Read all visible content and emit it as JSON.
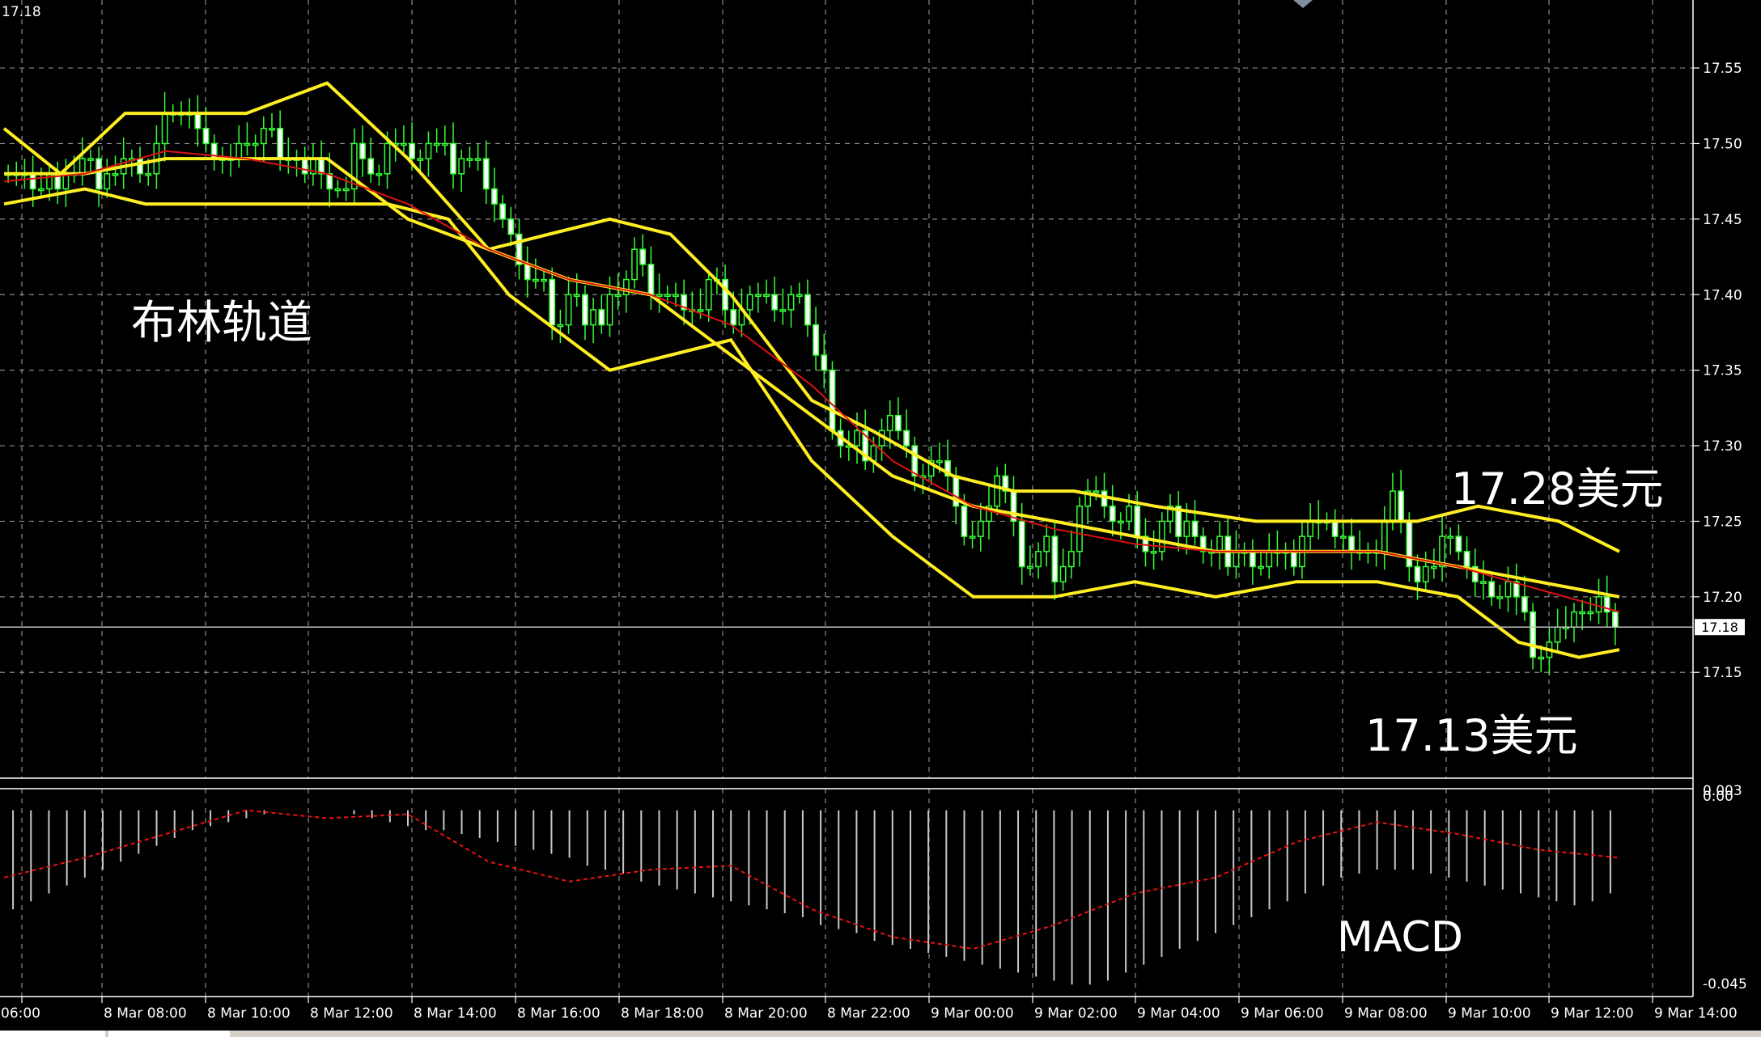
{
  "chart_data": [
    {
      "type": "candlestick",
      "corner_label": "17.18",
      "annotation_label": "布林轨道",
      "price_labels": [
        "17.28美元",
        "17.13美元"
      ],
      "current_price": "17.18",
      "ylim": [
        17.08,
        17.595
      ],
      "y_ticks": [
        "17.55",
        "17.50",
        "17.45",
        "17.40",
        "17.35",
        "17.30",
        "17.25",
        "17.20",
        "17.15"
      ],
      "x_ticks": [
        "06:00",
        "8 Mar 08:00",
        "8 Mar 10:00",
        "8 Mar 12:00",
        "8 Mar 14:00",
        "8 Mar 16:00",
        "8 Mar 18:00",
        "8 Mar 20:00",
        "8 Mar 22:00",
        "9 Mar 00:00",
        "9 Mar 02:00",
        "9 Mar 04:00",
        "9 Mar 06:00",
        "9 Mar 08:00",
        "9 Mar 10:00",
        "9 Mar 12:00",
        "9 Mar 14:00"
      ],
      "close": [
        17.48,
        17.48,
        17.48,
        17.47,
        17.47,
        17.48,
        17.47,
        17.48,
        17.48,
        17.49,
        17.49,
        17.47,
        17.48,
        17.48,
        17.49,
        17.49,
        17.48,
        17.48,
        17.5,
        17.52,
        17.52,
        17.52,
        17.52,
        17.51,
        17.5,
        17.49,
        17.49,
        17.49,
        17.5,
        17.5,
        17.5,
        17.51,
        17.51,
        17.49,
        17.49,
        17.49,
        17.48,
        17.49,
        17.48,
        17.47,
        17.47,
        17.47,
        17.5,
        17.49,
        17.48,
        17.48,
        17.5,
        17.5,
        17.5,
        17.49,
        17.49,
        17.5,
        17.5,
        17.5,
        17.48,
        17.49,
        17.49,
        17.49,
        17.47,
        17.46,
        17.45,
        17.44,
        17.42,
        17.41,
        17.41,
        17.41,
        17.38,
        17.38,
        17.4,
        17.4,
        17.38,
        17.39,
        17.38,
        17.4,
        17.4,
        17.41,
        17.43,
        17.42,
        17.4,
        17.4,
        17.4,
        17.4,
        17.39,
        17.39,
        17.39,
        17.41,
        17.41,
        17.39,
        17.38,
        17.39,
        17.4,
        17.4,
        17.4,
        17.39,
        17.39,
        17.4,
        17.4,
        17.38,
        17.36,
        17.35,
        17.31,
        17.3,
        17.3,
        17.31,
        17.29,
        17.3,
        17.31,
        17.32,
        17.31,
        17.3,
        17.28,
        17.28,
        17.29,
        17.29,
        17.28,
        17.26,
        17.24,
        17.24,
        17.25,
        17.26,
        17.28,
        17.27,
        17.25,
        17.22,
        17.22,
        17.23,
        17.24,
        17.21,
        17.22,
        17.23,
        17.26,
        17.27,
        17.27,
        17.26,
        17.25,
        17.25,
        17.26,
        17.24,
        17.23,
        17.23,
        17.25,
        17.26,
        17.24,
        17.25,
        17.24,
        17.23,
        17.23,
        17.24,
        17.22,
        17.23,
        17.23,
        17.22,
        17.22,
        17.23,
        17.23,
        17.23,
        17.22,
        17.24,
        17.25,
        17.25,
        17.25,
        17.24,
        17.24,
        17.23,
        17.23,
        17.23,
        17.23,
        17.25,
        17.27,
        17.25,
        17.22,
        17.21,
        17.22,
        17.22,
        17.24,
        17.24,
        17.23,
        17.22,
        17.21,
        17.21,
        17.2,
        17.2,
        17.21,
        17.2,
        17.19,
        17.16,
        17.16,
        17.17,
        17.18,
        17.18,
        17.19,
        17.19,
        17.19,
        17.2,
        17.19,
        17.18
      ],
      "open": [
        17.48,
        17.48,
        17.48,
        17.48,
        17.47,
        17.47,
        17.48,
        17.47,
        17.48,
        17.48,
        17.49,
        17.49,
        17.47,
        17.48,
        17.48,
        17.49,
        17.49,
        17.48,
        17.48,
        17.5,
        17.52,
        17.52,
        17.52,
        17.52,
        17.51,
        17.5,
        17.49,
        17.49,
        17.49,
        17.5,
        17.5,
        17.5,
        17.51,
        17.51,
        17.49,
        17.49,
        17.49,
        17.48,
        17.49,
        17.48,
        17.47,
        17.47,
        17.47,
        17.5,
        17.49,
        17.48,
        17.48,
        17.5,
        17.5,
        17.5,
        17.49,
        17.49,
        17.5,
        17.5,
        17.5,
        17.48,
        17.49,
        17.49,
        17.49,
        17.47,
        17.46,
        17.45,
        17.44,
        17.42,
        17.41,
        17.41,
        17.41,
        17.38,
        17.38,
        17.4,
        17.4,
        17.38,
        17.39,
        17.38,
        17.4,
        17.4,
        17.41,
        17.43,
        17.42,
        17.4,
        17.4,
        17.4,
        17.4,
        17.39,
        17.39,
        17.39,
        17.41,
        17.41,
        17.39,
        17.38,
        17.39,
        17.4,
        17.4,
        17.4,
        17.39,
        17.39,
        17.4,
        17.4,
        17.38,
        17.36,
        17.35,
        17.31,
        17.3,
        17.3,
        17.31,
        17.29,
        17.3,
        17.31,
        17.32,
        17.31,
        17.3,
        17.28,
        17.28,
        17.29,
        17.29,
        17.28,
        17.26,
        17.24,
        17.24,
        17.25,
        17.26,
        17.28,
        17.27,
        17.25,
        17.22,
        17.22,
        17.23,
        17.24,
        17.21,
        17.22,
        17.23,
        17.26,
        17.27,
        17.27,
        17.26,
        17.25,
        17.25,
        17.26,
        17.24,
        17.23,
        17.23,
        17.25,
        17.26,
        17.24,
        17.25,
        17.24,
        17.23,
        17.23,
        17.24,
        17.22,
        17.23,
        17.23,
        17.22,
        17.22,
        17.23,
        17.23,
        17.23,
        17.22,
        17.24,
        17.25,
        17.25,
        17.25,
        17.24,
        17.24,
        17.23,
        17.23,
        17.23,
        17.23,
        17.25,
        17.27,
        17.25,
        17.22,
        17.21,
        17.22,
        17.22,
        17.24,
        17.24,
        17.23,
        17.22,
        17.21,
        17.21,
        17.2,
        17.2,
        17.21,
        17.2,
        17.19,
        17.16,
        17.16,
        17.17,
        17.18,
        17.18,
        17.19,
        17.19,
        17.19,
        17.2,
        17.19
      ],
      "bollinger": {
        "upper": [
          [
            0,
            17.51
          ],
          [
            14,
            17.48
          ],
          [
            30,
            17.52
          ],
          [
            60,
            17.52
          ],
          [
            80,
            17.54
          ],
          [
            100,
            17.49
          ],
          [
            120,
            17.43
          ],
          [
            135,
            17.44
          ],
          [
            150,
            17.45
          ],
          [
            165,
            17.44
          ],
          [
            180,
            17.4
          ],
          [
            200,
            17.33
          ],
          [
            215,
            17.31
          ],
          [
            235,
            17.28
          ],
          [
            250,
            17.27
          ],
          [
            265,
            17.27
          ],
          [
            285,
            17.26
          ],
          [
            310,
            17.25
          ],
          [
            330,
            17.25
          ],
          [
            350,
            17.25
          ],
          [
            365,
            17.26
          ],
          [
            385,
            17.25
          ],
          [
            400,
            17.23
          ]
        ],
        "middle": [
          [
            0,
            17.48
          ],
          [
            20,
            17.48
          ],
          [
            40,
            17.49
          ],
          [
            60,
            17.49
          ],
          [
            80,
            17.49
          ],
          [
            100,
            17.45
          ],
          [
            120,
            17.43
          ],
          [
            140,
            17.41
          ],
          [
            160,
            17.4
          ],
          [
            180,
            17.36
          ],
          [
            200,
            17.32
          ],
          [
            220,
            17.28
          ],
          [
            240,
            17.26
          ],
          [
            260,
            17.25
          ],
          [
            280,
            17.24
          ],
          [
            300,
            17.23
          ],
          [
            320,
            17.23
          ],
          [
            340,
            17.23
          ],
          [
            360,
            17.22
          ],
          [
            380,
            17.21
          ],
          [
            400,
            17.2
          ]
        ],
        "lower": [
          [
            0,
            17.46
          ],
          [
            20,
            17.47
          ],
          [
            35,
            17.46
          ],
          [
            55,
            17.46
          ],
          [
            75,
            17.46
          ],
          [
            95,
            17.46
          ],
          [
            110,
            17.45
          ],
          [
            125,
            17.4
          ],
          [
            150,
            17.35
          ],
          [
            165,
            17.36
          ],
          [
            180,
            17.37
          ],
          [
            200,
            17.29
          ],
          [
            220,
            17.24
          ],
          [
            240,
            17.2
          ],
          [
            260,
            17.2
          ],
          [
            280,
            17.21
          ],
          [
            300,
            17.2
          ],
          [
            320,
            17.21
          ],
          [
            340,
            17.21
          ],
          [
            360,
            17.2
          ],
          [
            375,
            17.17
          ],
          [
            390,
            17.16
          ],
          [
            400,
            17.165
          ]
        ]
      },
      "sma": [
        [
          0,
          17.475
        ],
        [
          20,
          17.48
        ],
        [
          40,
          17.495
        ],
        [
          60,
          17.49
        ],
        [
          80,
          17.48
        ],
        [
          100,
          17.46
        ],
        [
          120,
          17.43
        ],
        [
          140,
          17.41
        ],
        [
          160,
          17.4
        ],
        [
          180,
          17.38
        ],
        [
          200,
          17.34
        ],
        [
          220,
          17.29
        ],
        [
          240,
          17.26
        ],
        [
          260,
          17.245
        ],
        [
          280,
          17.235
        ],
        [
          300,
          17.23
        ],
        [
          320,
          17.23
        ],
        [
          340,
          17.23
        ],
        [
          360,
          17.22
        ],
        [
          380,
          17.205
        ],
        [
          400,
          17.19
        ]
      ]
    },
    {
      "type": "bar",
      "indicator_label": "MACD",
      "y_ticks": [
        "0.003",
        "0.00",
        "-0.045"
      ],
      "ylim": [
        -0.045,
        0.003
      ],
      "histogram": [
        -0.025,
        -0.023,
        -0.021,
        -0.019,
        -0.017,
        -0.015,
        -0.013,
        -0.011,
        -0.009,
        -0.007,
        -0.005,
        -0.004,
        -0.003,
        -0.002,
        -0.001,
        0.0,
        0.0,
        0.0,
        0.0,
        -0.001,
        -0.002,
        -0.003,
        -0.004,
        -0.005,
        -0.005,
        -0.006,
        -0.007,
        -0.008,
        -0.009,
        -0.01,
        -0.011,
        -0.012,
        -0.014,
        -0.015,
        -0.016,
        -0.018,
        -0.019,
        -0.02,
        -0.021,
        -0.022,
        -0.023,
        -0.024,
        -0.025,
        -0.026,
        -0.027,
        -0.029,
        -0.03,
        -0.031,
        -0.033,
        -0.034,
        -0.035,
        -0.036,
        -0.037,
        -0.038,
        -0.039,
        -0.04,
        -0.041,
        -0.042,
        -0.043,
        -0.044,
        -0.044,
        -0.043,
        -0.041,
        -0.039,
        -0.037,
        -0.035,
        -0.033,
        -0.031,
        -0.029,
        -0.027,
        -0.025,
        -0.023,
        -0.021,
        -0.019,
        -0.017,
        -0.016,
        -0.015,
        -0.015,
        -0.015,
        -0.016,
        -0.017,
        -0.018,
        -0.019,
        -0.02,
        -0.021,
        -0.022,
        -0.023,
        -0.024,
        -0.023,
        -0.021
      ],
      "signal": [
        [
          0,
          -0.017
        ],
        [
          20,
          -0.012
        ],
        [
          40,
          -0.006
        ],
        [
          60,
          0.0
        ],
        [
          80,
          -0.002
        ],
        [
          100,
          -0.001
        ],
        [
          120,
          -0.013
        ],
        [
          140,
          -0.018
        ],
        [
          160,
          -0.015
        ],
        [
          180,
          -0.014
        ],
        [
          200,
          -0.025
        ],
        [
          220,
          -0.032
        ],
        [
          240,
          -0.035
        ],
        [
          260,
          -0.029
        ],
        [
          280,
          -0.021
        ],
        [
          300,
          -0.017
        ],
        [
          320,
          -0.008
        ],
        [
          340,
          -0.003
        ],
        [
          360,
          -0.006
        ],
        [
          380,
          -0.01
        ],
        [
          400,
          -0.012
        ]
      ]
    }
  ]
}
